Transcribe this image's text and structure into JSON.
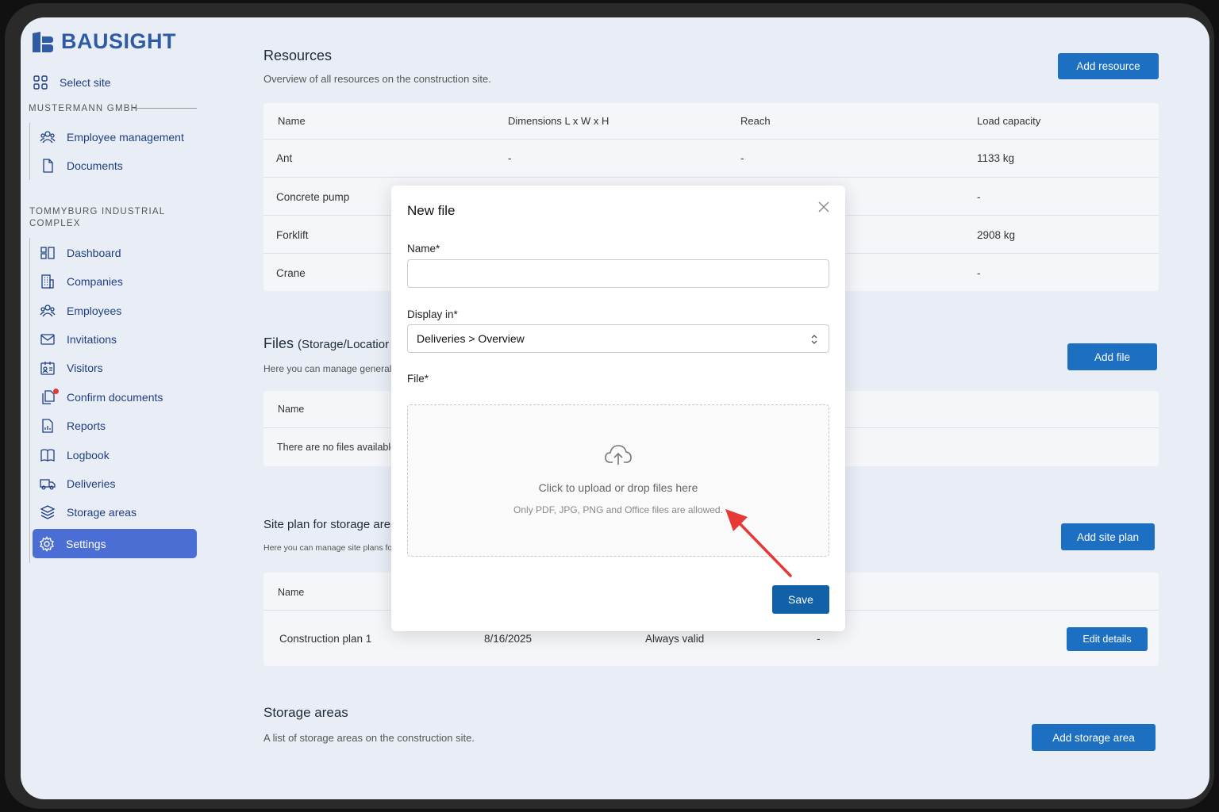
{
  "app": {
    "name": "BAUSIGHT"
  },
  "sidebar": {
    "select_site": "Select site",
    "company_section": "MUSTERMANN GMBH",
    "company_items": [
      {
        "label": "Employee management",
        "icon": "users-icon"
      },
      {
        "label": "Documents",
        "icon": "document-icon"
      }
    ],
    "site_section": "TOMMYBURG INDUSTRIAL COMPLEX",
    "site_items": [
      {
        "label": "Dashboard",
        "icon": "dashboard-icon"
      },
      {
        "label": "Companies",
        "icon": "building-icon"
      },
      {
        "label": "Employees",
        "icon": "users-icon"
      },
      {
        "label": "Invitations",
        "icon": "mail-icon"
      },
      {
        "label": "Visitors",
        "icon": "visitor-icon"
      },
      {
        "label": "Confirm documents",
        "icon": "copy-documents-icon"
      },
      {
        "label": "Reports",
        "icon": "report-icon"
      },
      {
        "label": "Logbook",
        "icon": "book-icon"
      },
      {
        "label": "Deliveries",
        "icon": "truck-icon"
      },
      {
        "label": "Storage areas",
        "icon": "layers-icon"
      }
    ],
    "active_item": {
      "label": "Settings",
      "icon": "gear-icon"
    }
  },
  "resources": {
    "title": "Resources",
    "subtitle": "Overview of all resources on the construction site.",
    "add_label": "Add resource",
    "columns": [
      "Name",
      "Dimensions L x W x H",
      "Reach",
      "Load capacity"
    ],
    "rows": [
      [
        "Ant",
        "-",
        "-",
        "1133 kg"
      ],
      [
        "Concrete pump",
        "",
        "",
        "-"
      ],
      [
        "Forklift",
        "",
        "",
        "2908 kg"
      ],
      [
        "Crane",
        "",
        "",
        "-"
      ]
    ]
  },
  "files": {
    "title": "Files",
    "title_suffix": "(Storage/Locatior",
    "subtitle": "Here you can manage general fil",
    "add_label": "Add file",
    "columns": [
      "Name"
    ],
    "empty": "There are no files available."
  },
  "site_plan": {
    "title": "Site plan for storage areas",
    "subtitle": "Here you can manage site plans for stor",
    "add_label": "Add site plan",
    "columns": [
      "Name"
    ],
    "rows": [
      {
        "name": "Construction plan 1",
        "date": "8/16/2025",
        "validity": "Always valid",
        "extra": "-",
        "action": "Edit details"
      }
    ]
  },
  "storage_areas": {
    "title": "Storage areas",
    "subtitle": "A list of storage areas on the construction site.",
    "add_label": "Add storage area"
  },
  "modal": {
    "title": "New file",
    "name_label": "Name*",
    "name_value": "",
    "display_label": "Display in*",
    "display_value": "Deliveries > Overview",
    "file_label": "File*",
    "upload_text": "Click to upload or drop files here",
    "upload_hint": "Only PDF, JPG, PNG and Office files are allowed.",
    "save_label": "Save"
  },
  "colors": {
    "brand": "#2f5ba6",
    "primary_button": "#1d6fc2",
    "active_nav": "#4a6ed4",
    "annotation_arrow": "#e53935"
  }
}
